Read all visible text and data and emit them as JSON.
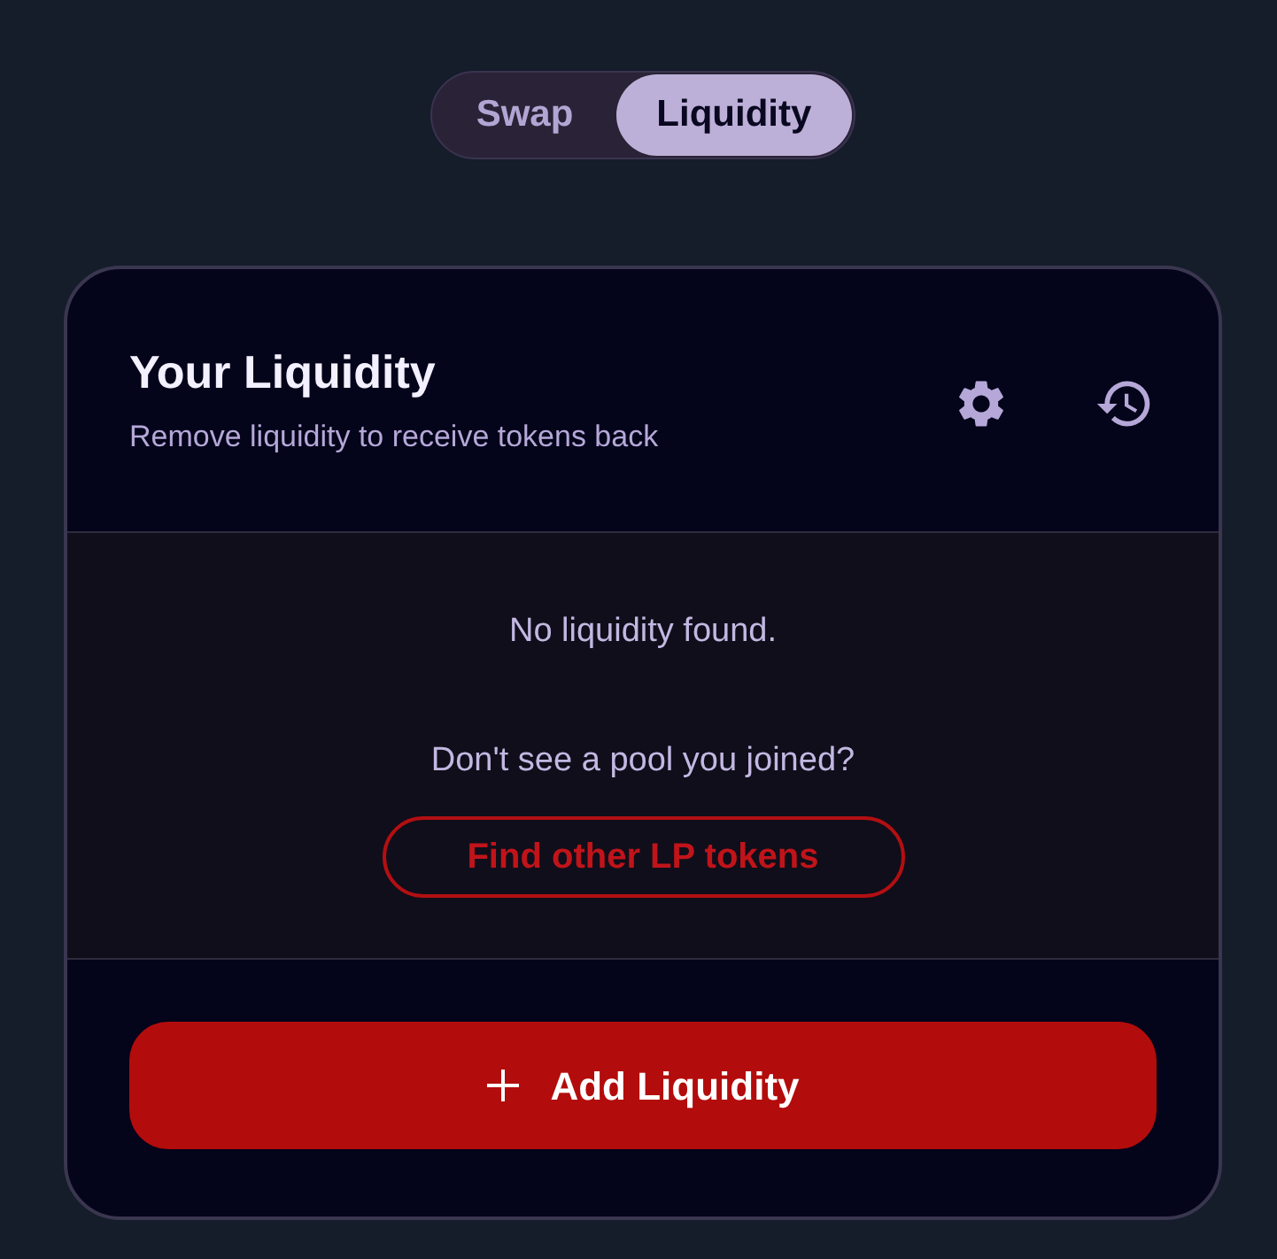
{
  "tabs": [
    {
      "label": "Swap",
      "selected": false
    },
    {
      "label": "Liquidity",
      "selected": true
    }
  ],
  "card": {
    "title": "Your Liquidity",
    "subtitle": "Remove liquidity to receive tokens back"
  },
  "empty_state": {
    "message": "No liquidity found.",
    "prompt": "Don't see a pool you joined?",
    "find_button": "Find other LP tokens"
  },
  "add_button": {
    "label": "Add Liquidity"
  }
}
